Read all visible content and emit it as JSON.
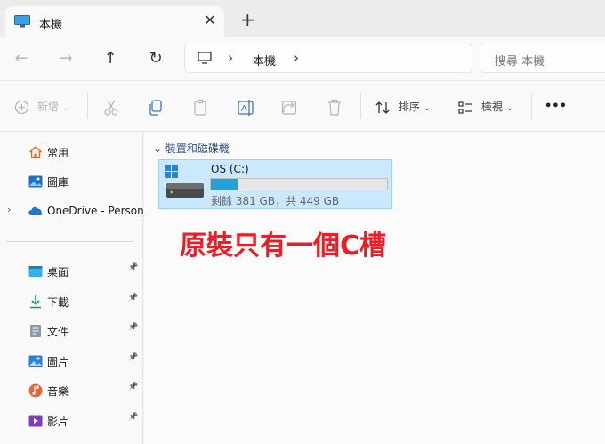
{
  "window": {
    "tab_title": "本機",
    "tab_close": "✕",
    "new_tab": "+"
  },
  "address": {
    "back": "←",
    "forward": "→",
    "up": "↑",
    "refresh": "↻",
    "chevron": "›",
    "path_label": "本機",
    "search_placeholder": "搜尋 本機"
  },
  "toolbar": {
    "new_label": "新增",
    "sort_label": "排序",
    "view_label": "檢視",
    "more": "•••",
    "dropdown": "⌄"
  },
  "sidebar": {
    "pin": "📌",
    "expand": "›",
    "items": [
      {
        "label": "常用",
        "icon": "home-icon"
      },
      {
        "label": "圖庫",
        "icon": "gallery-icon"
      },
      {
        "label": "OneDrive - Person",
        "icon": "onedrive-icon"
      },
      {
        "label": "桌面",
        "icon": "desktop-icon"
      },
      {
        "label": "下載",
        "icon": "download-icon"
      },
      {
        "label": "文件",
        "icon": "documents-icon"
      },
      {
        "label": "圖片",
        "icon": "pictures-icon"
      },
      {
        "label": "音樂",
        "icon": "music-icon"
      },
      {
        "label": "影片",
        "icon": "videos-icon"
      }
    ]
  },
  "content": {
    "group_label": "⌄ 裝置和磁碟機",
    "drive": {
      "name": "OS (C:)",
      "free_text": "剩餘 381 GB，共 449 GB",
      "used_fraction": 0.151
    },
    "annotation": "原裝只有一個C槽"
  },
  "colors": {
    "accent": "#26a0da",
    "selection": "#cce8ff",
    "annotation": "#ee1c24"
  }
}
